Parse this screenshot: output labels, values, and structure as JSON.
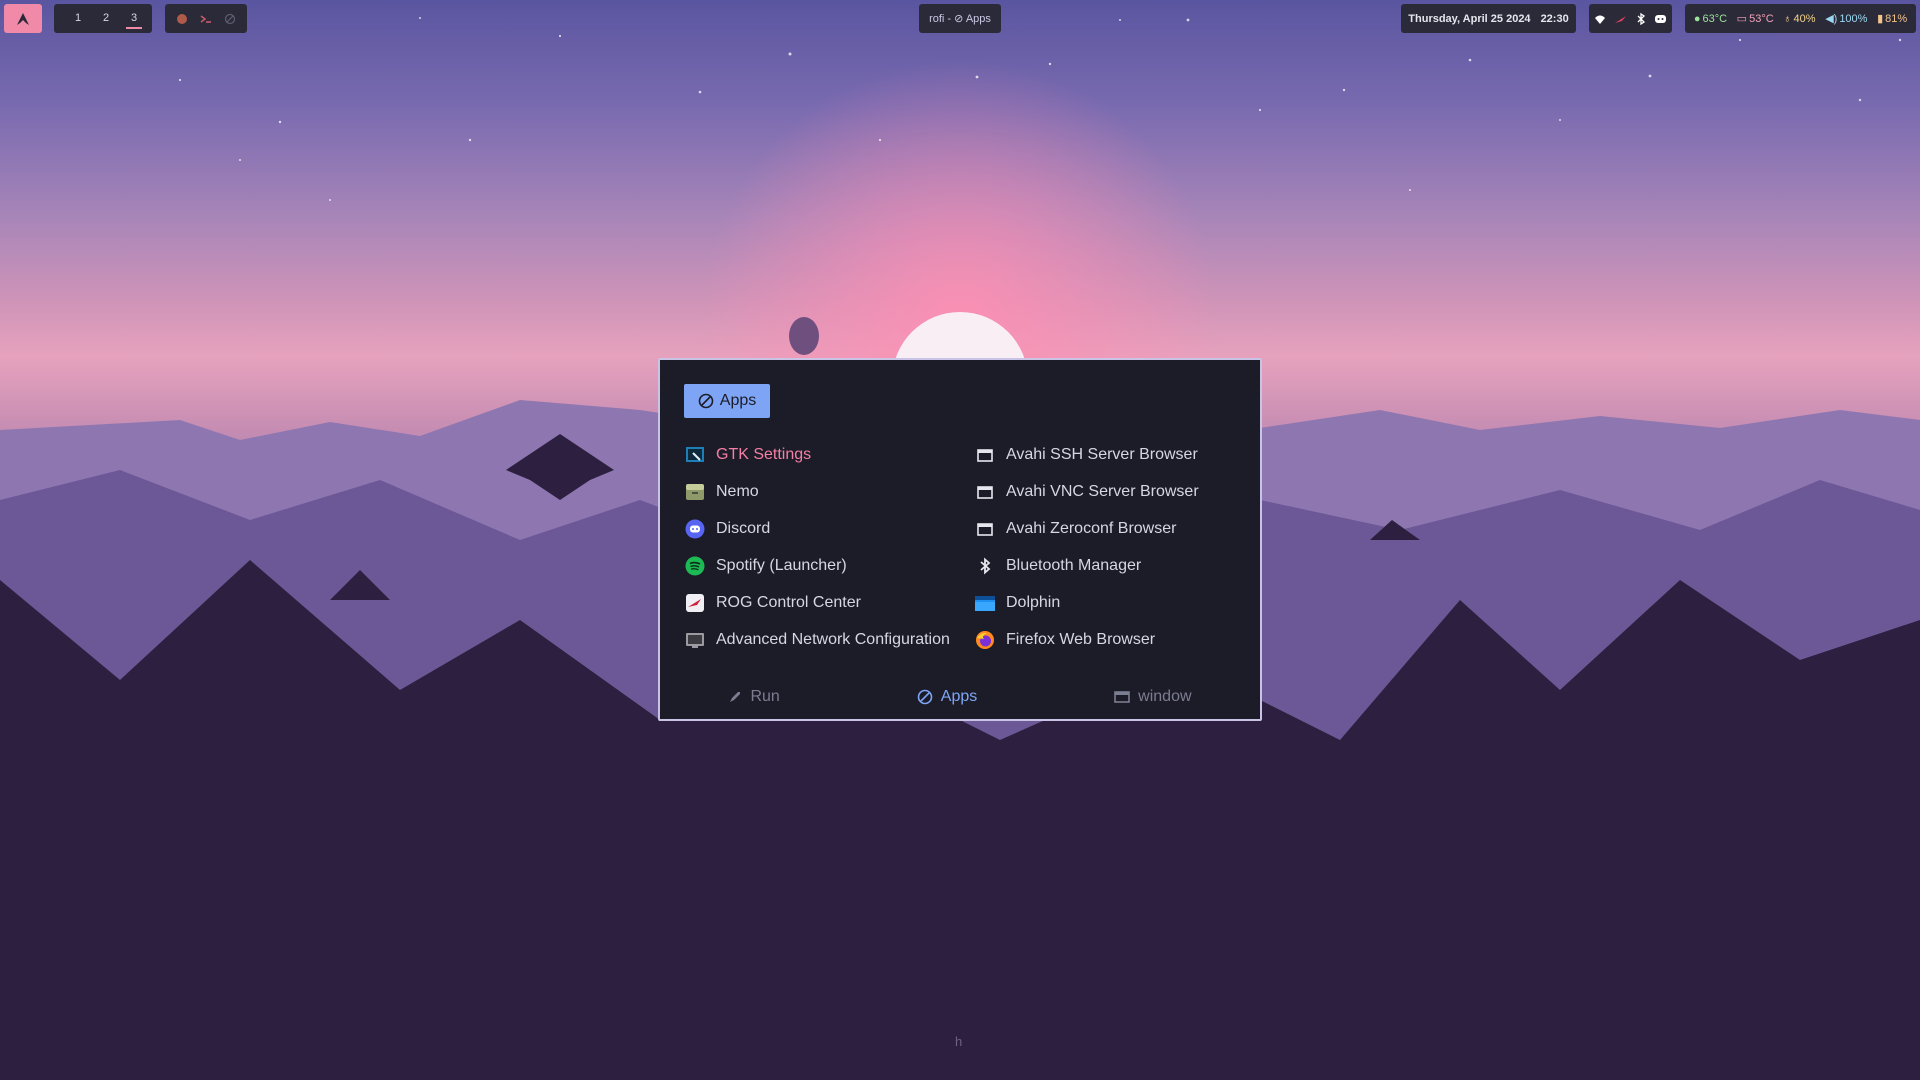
{
  "topbar": {
    "workspaces": [
      "1",
      "2",
      "3"
    ],
    "active_workspace": "3",
    "window_title": "rofi - ⊘ Apps",
    "date": "Thursday, April 25 2024",
    "time": "22:30",
    "stats": [
      {
        "icon": "cpu-temp-icon",
        "value": "63°C",
        "color": "#9be39b"
      },
      {
        "icon": "gpu-temp-icon",
        "value": "53°C",
        "color": "#f4a0b8"
      },
      {
        "icon": "brightness-icon",
        "value": "40%",
        "color": "#f4d48a"
      },
      {
        "icon": "volume-icon",
        "value": "100%",
        "color": "#9bd7f0"
      },
      {
        "icon": "battery-icon",
        "value": "81%",
        "color": "#f4c48a"
      }
    ]
  },
  "rofi": {
    "mode_label": "Apps",
    "entries_left": [
      {
        "label": "GTK Settings",
        "icon": "gtk-settings-icon"
      },
      {
        "label": "Nemo",
        "icon": "nemo-icon"
      },
      {
        "label": "Discord",
        "icon": "discord-icon"
      },
      {
        "label": "Spotify (Launcher)",
        "icon": "spotify-icon"
      },
      {
        "label": "ROG Control Center",
        "icon": "rog-icon"
      },
      {
        "label": "Advanced Network Configuration",
        "icon": "network-config-icon"
      }
    ],
    "entries_right": [
      {
        "label": "Avahi SSH Server Browser",
        "icon": "window-icon"
      },
      {
        "label": "Avahi VNC Server Browser",
        "icon": "window-icon"
      },
      {
        "label": "Avahi Zeroconf Browser",
        "icon": "window-icon"
      },
      {
        "label": "Bluetooth Manager",
        "icon": "bluetooth-icon"
      },
      {
        "label": "Dolphin",
        "icon": "dolphin-icon"
      },
      {
        "label": "Firefox Web Browser",
        "icon": "firefox-icon"
      }
    ],
    "selected": "GTK Settings",
    "tabs": [
      {
        "label": "Run",
        "icon": "rocket-icon",
        "active": false
      },
      {
        "label": "Apps",
        "icon": "apps-icon",
        "active": true
      },
      {
        "label": "window",
        "icon": "window-icon",
        "active": false
      }
    ]
  },
  "bottom_text": "h",
  "colors": {
    "accent": "#7ea5f5",
    "selected_text": "#f47fa4",
    "bar_bg": "#2b2a38",
    "rofi_bg": "#1c1c28"
  }
}
